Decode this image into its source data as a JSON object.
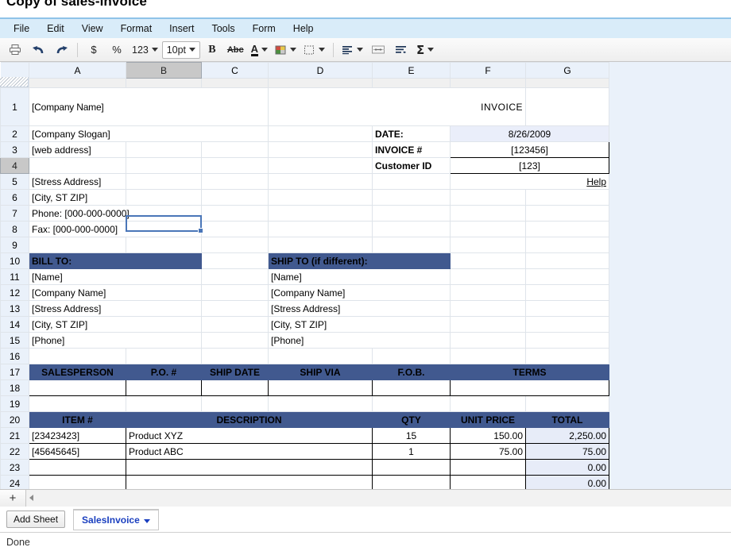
{
  "window": {
    "title": "Copy of sales-invoice"
  },
  "menu": {
    "items": [
      "File",
      "Edit",
      "View",
      "Format",
      "Insert",
      "Tools",
      "Form",
      "Help"
    ]
  },
  "toolbar": {
    "print_icon": "print-icon",
    "undo_icon": "undo-icon",
    "redo_icon": "redo-icon",
    "currency_label": "$",
    "percent_label": "%",
    "number_label": "123",
    "font_size_label": "10pt",
    "bold_label": "B",
    "strikethrough_label": "Abc",
    "text_color_label": "A",
    "fill_color_icon": "fill-color-icon",
    "borders_icon": "borders-icon",
    "align_icon": "align-icon",
    "merge_icon": "merge-cells-icon",
    "wrap_icon": "wrap-text-icon",
    "sum_label": "Σ"
  },
  "grid": {
    "columns": [
      "A",
      "B",
      "C",
      "D",
      "E",
      "F",
      "G"
    ],
    "active_column": "B",
    "active_row": 4,
    "selected_cell": "B4",
    "rows": [
      1,
      2,
      3,
      4,
      5,
      6,
      7,
      8,
      9,
      10,
      11,
      12,
      13,
      14,
      15,
      16,
      17,
      18,
      19,
      20,
      21,
      22,
      23,
      24
    ]
  },
  "invoice": {
    "company_name": "[Company Name]",
    "company_slogan": "[Company Slogan]",
    "web_address": "[web address]",
    "street_address": "[Stress Address]",
    "city_state_zip": "[City, ST ZIP]",
    "phone": "Phone: [000-000-0000]",
    "fax": "Fax: [000-000-0000]",
    "title": "INVOICE",
    "date_label": "DATE:",
    "date_value": "8/26/2009",
    "invoice_no_label": "INVOICE #",
    "invoice_no_value": "[123456]",
    "customer_id_label": "Customer ID",
    "customer_id_value": "[123]",
    "help_link": "Help",
    "bill_to_header": "BILL TO:",
    "ship_to_header": "SHIP TO (if different):",
    "bill_to": [
      "[Name]",
      "[Company Name]",
      "[Stress Address]",
      "[City, ST ZIP]",
      "[Phone]"
    ],
    "ship_to": [
      "[Name]",
      "[Company Name]",
      "[Stress Address]",
      "[City, ST ZIP]",
      "[Phone]"
    ],
    "terms_headers": [
      "SALESPERSON",
      "P.O. #",
      "SHIP DATE",
      "SHIP VIA",
      "F.O.B.",
      "TERMS"
    ],
    "terms_values": [
      "",
      "",
      "",
      "",
      "",
      ""
    ],
    "item_headers": [
      "ITEM #",
      "DESCRIPTION",
      "QTY",
      "UNIT PRICE",
      "TOTAL"
    ],
    "items": [
      {
        "item_no": "[23423423]",
        "description": "Product XYZ",
        "qty": "15",
        "unit_price": "150.00",
        "total": "2,250.00"
      },
      {
        "item_no": "[45645645]",
        "description": "Product ABC",
        "qty": "1",
        "unit_price": "75.00",
        "total": "75.00"
      },
      {
        "item_no": "",
        "description": "",
        "qty": "",
        "unit_price": "",
        "total": "0.00"
      },
      {
        "item_no": "",
        "description": "",
        "qty": "",
        "unit_price": "",
        "total": "0.00"
      }
    ]
  },
  "bottom": {
    "add_row_label": "+",
    "add_sheet_label": "Add Sheet",
    "sheet_tab_label": "SalesInvoice"
  },
  "status": {
    "text": "Done"
  },
  "colors": {
    "header_navy": "#41598f",
    "invoice_title": "#8f9dd0",
    "total_tint": "#e7ecf8",
    "menu_bg": "#d9ecf9",
    "link_blue": "#2222cc"
  }
}
